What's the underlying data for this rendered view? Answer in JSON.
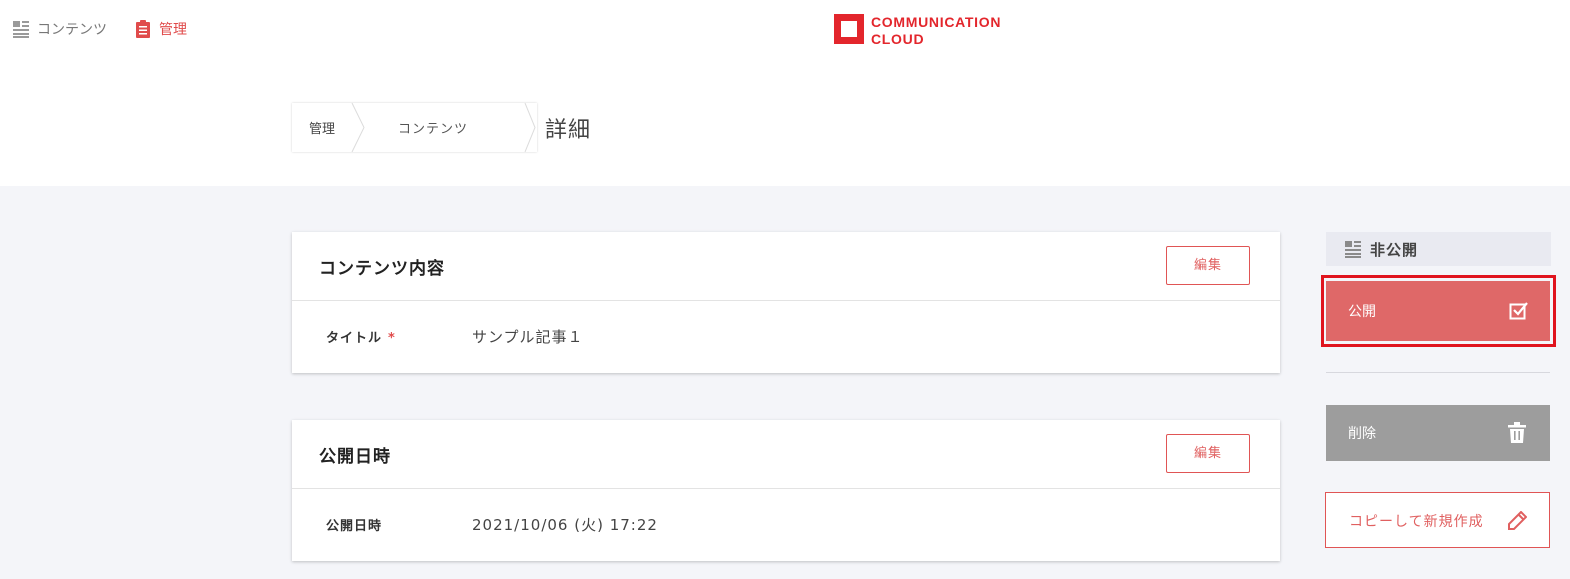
{
  "nav": {
    "contents_label": "コンテンツ",
    "admin_label": "管理"
  },
  "logo": {
    "line1": "COMMUNICATION",
    "line2": "CLOUD"
  },
  "breadcrumb": {
    "items": [
      "管理",
      "コンテンツ"
    ],
    "current": "詳細"
  },
  "content_card": {
    "title": "コンテンツ内容",
    "edit_label": "編集",
    "field_label": "タイトル",
    "required_mark": "*",
    "field_value": "サンプル記事１"
  },
  "publish_card": {
    "title": "公開日時",
    "edit_label": "編集",
    "field_label": "公開日時",
    "field_value": "2021/10/06 (火) 17:22"
  },
  "sidebar": {
    "status": "非公開",
    "publish_label": "公開",
    "delete_label": "削除",
    "copy_label": "コピーして新規作成"
  },
  "colors": {
    "accent": "#e04b4b",
    "brand": "#e3262c",
    "publish_bg": "#df6868",
    "delete_bg": "#9d9d9d",
    "highlight": "#e0141e"
  },
  "icons": {
    "contents": "list-icon",
    "admin": "clipboard-icon",
    "status": "list-icon",
    "publish": "checkbox-icon",
    "delete": "trash-icon",
    "copy": "pencil-icon"
  }
}
